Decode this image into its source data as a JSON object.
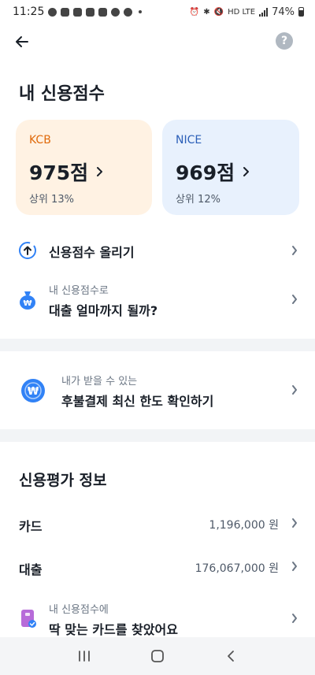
{
  "status_bar": {
    "time": "11:25",
    "network": "HD LTE",
    "battery": "74%"
  },
  "header": {
    "title": "내 신용점수",
    "help_label": "?"
  },
  "scores": [
    {
      "agency": "KCB",
      "score": "975점",
      "rank": "상위 13%"
    },
    {
      "agency": "NICE",
      "score": "969점",
      "rank": "상위 12%"
    }
  ],
  "actions": {
    "raise": {
      "label": "신용점수 올리기"
    },
    "loan": {
      "sub": "내 신용점수로",
      "main": "대출 얼마까지 될까?"
    }
  },
  "bnpl": {
    "sub": "내가 받을 수 있는",
    "main": "후불결제 최신 한도 확인하기"
  },
  "credit_info": {
    "title": "신용평가 정보",
    "items": [
      {
        "label": "카드",
        "value": "1,196,000 원"
      },
      {
        "label": "대출",
        "value": "176,067,000 원"
      }
    ],
    "card_promo": {
      "sub": "내 신용점수에",
      "main": "딱 맞는 카드를 찾았어요"
    }
  },
  "colors": {
    "kcb_accent": "#e06a0b",
    "nice_accent": "#2b5fb8",
    "kcb_bg": "#fff2e3",
    "nice_bg": "#e8f1fd",
    "brand_blue": "#3182f6"
  },
  "icons": {
    "back": "arrow-left-icon",
    "help": "question-icon",
    "raise": "arrow-up-circle-icon",
    "loan": "money-bag-icon",
    "bnpl": "won-coin-icon",
    "card": "card-icon",
    "chevron": "chevron-right-icon"
  }
}
